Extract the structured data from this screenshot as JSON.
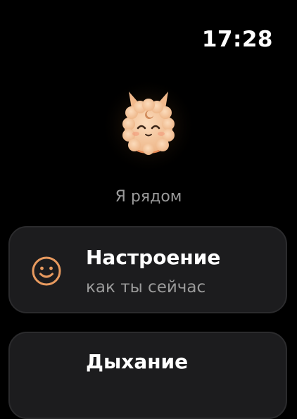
{
  "status": {
    "time": "17:28"
  },
  "home": {
    "subtitle": "Я рядом"
  },
  "cards": [
    {
      "title": "Настроение",
      "description": "как ты сейчас",
      "icon": "smiley-face-icon"
    },
    {
      "title": "Дыхание",
      "icon": ""
    }
  ],
  "colors": {
    "background": "#000000",
    "card": "#1c1c1e",
    "accent": "#e89a5f",
    "mascot": "#f6c9a0",
    "muted_text": "#9a9a9a"
  }
}
